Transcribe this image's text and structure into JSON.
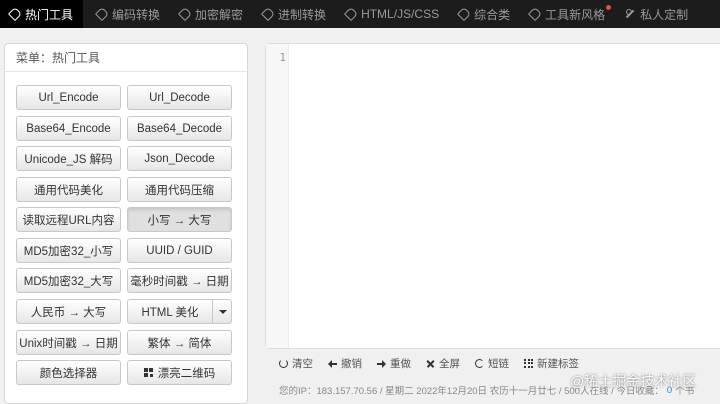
{
  "nav": [
    {
      "label": "热门工具",
      "icon": "tag-icon",
      "active": true
    },
    {
      "label": "编码转换",
      "icon": "tag-icon"
    },
    {
      "label": "加密解密",
      "icon": "tag-icon"
    },
    {
      "label": "进制转换",
      "icon": "tag-icon"
    },
    {
      "label": "HTML/JS/CSS",
      "icon": "tag-icon"
    },
    {
      "label": "综合类",
      "icon": "tag-icon"
    },
    {
      "label": "工具新风格",
      "icon": "tag-icon",
      "badge": true
    },
    {
      "label": "私人定制",
      "icon": "wrench-icon"
    }
  ],
  "menu": {
    "title": "菜单：热门工具",
    "buttons": [
      {
        "left": "Url_Encode",
        "right": "Url_Decode"
      },
      {
        "left": "Base64_Encode",
        "right": "Base64_Decode"
      },
      {
        "left": "Unicode_JS 解码",
        "right": "Json_Decode"
      },
      {
        "left": "通用代码美化",
        "right": "通用代码压缩"
      },
      {
        "left": "读取远程URL内容",
        "right": "小写 → 大写"
      },
      {
        "left": "MD5加密32_小写",
        "right": "UUID / GUID"
      },
      {
        "left": "MD5加密32_大写",
        "right": "毫秒时间戳 → 日期"
      },
      {
        "left": "人民币 → 大写",
        "right": "HTML 美化"
      },
      {
        "left": "Unix时间戳 → 日期",
        "right": "繁体 → 简体"
      },
      {
        "left": "颜色选择器",
        "right": "漂亮二维码"
      }
    ]
  },
  "editor": {
    "line_number": "1",
    "content": ""
  },
  "toolbar": [
    {
      "label": "清空",
      "icon": "clear-icon"
    },
    {
      "label": "撤销",
      "icon": "undo-icon"
    },
    {
      "label": "重做",
      "icon": "redo-icon"
    },
    {
      "label": "全屏",
      "icon": "fullscreen-icon"
    },
    {
      "label": "短链",
      "icon": "link-icon"
    },
    {
      "label": "新建标签",
      "icon": "grid-icon"
    }
  ],
  "status": {
    "prefix": "您的IP：183.157.70.56 / 星期二 2022年12月20日 农历十一月廿七 / 500人在线 / 今日收藏：",
    "count": "0",
    "suffix": "个书"
  },
  "watermark": "@稀土掘金技术社区",
  "colors": {
    "nav_bg": "#1c1c1c",
    "nav_active_bg": "#000000",
    "badge": "#e74c3c",
    "count": "#1e88e5"
  }
}
